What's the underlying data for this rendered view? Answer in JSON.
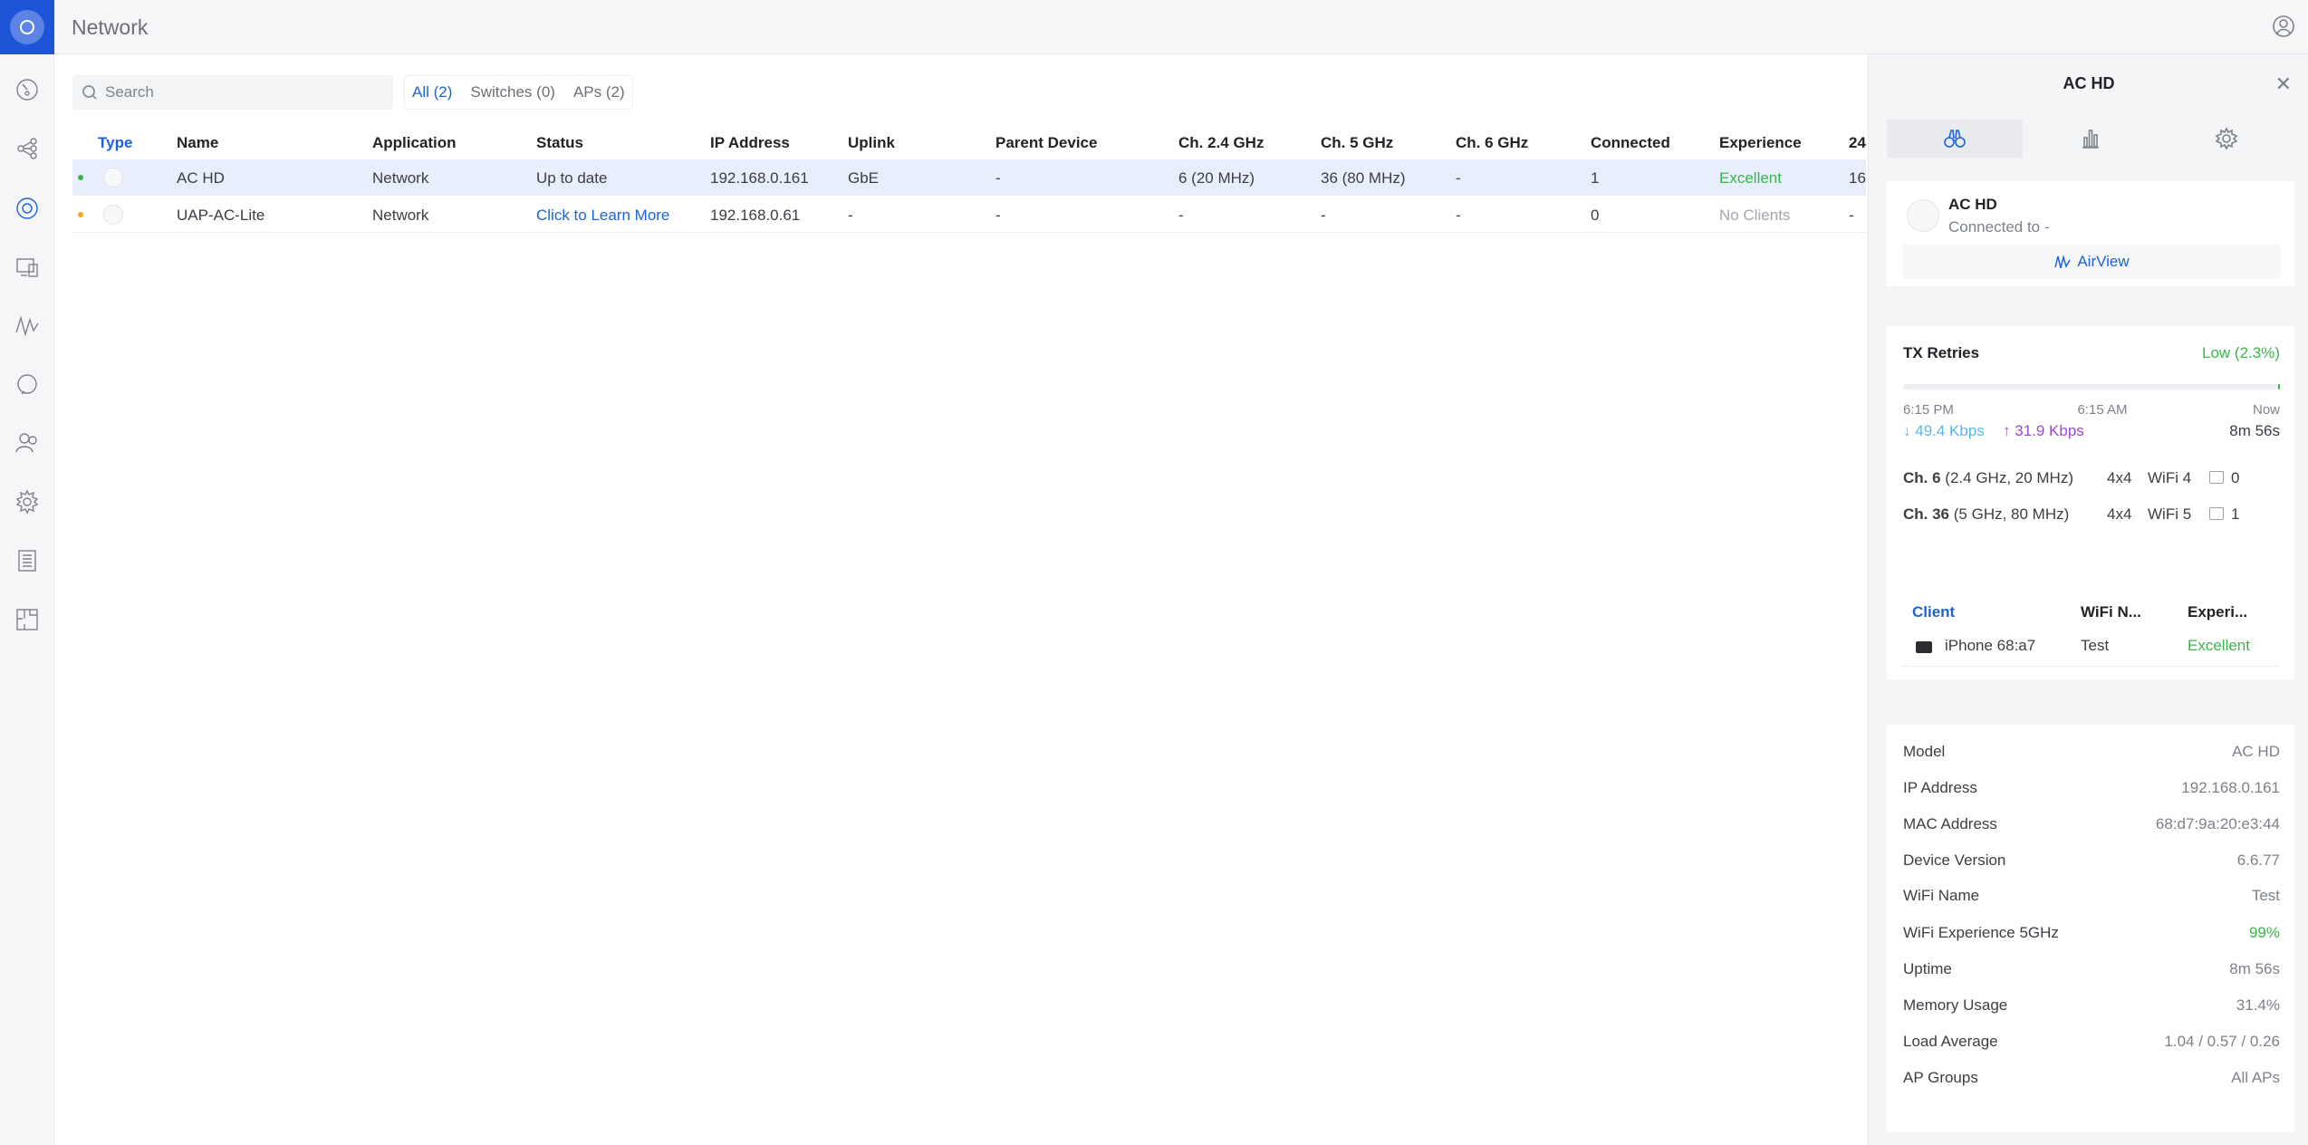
{
  "app": {
    "title": "Network"
  },
  "search": {
    "placeholder": "Search"
  },
  "filters": [
    {
      "label": "All (2)",
      "active": true
    },
    {
      "label": "Switches (0)",
      "active": false
    },
    {
      "label": "APs (2)",
      "active": false
    }
  ],
  "table": {
    "columns": [
      "Type",
      "Name",
      "Application",
      "Status",
      "IP Address",
      "Uplink",
      "Parent Device",
      "Ch. 2.4 GHz",
      "Ch. 5 GHz",
      "Ch. 6 GHz",
      "Connected",
      "Experience",
      "24"
    ],
    "rows": [
      {
        "status_color": "#3ab54a",
        "name": "AC HD",
        "application": "Network",
        "status": "Up to date",
        "ip": "192.168.0.161",
        "uplink": "GbE",
        "parent": "-",
        "ch24": "6 (20 MHz)",
        "ch5": "36 (80 MHz)",
        "ch6": "-",
        "connected": "1",
        "experience": "Excellent",
        "extra": "16"
      },
      {
        "status_color": "#f5a623",
        "name": "UAP-AC-Lite",
        "application": "Network",
        "status": "Click to Learn More",
        "ip": "192.168.0.61",
        "uplink": "-",
        "parent": "-",
        "ch24": "-",
        "ch5": "-",
        "ch6": "-",
        "connected": "0",
        "experience": "No Clients",
        "extra": "-"
      }
    ]
  },
  "panel": {
    "title": "AC HD",
    "tab_icons": [
      "binoculars-icon",
      "bar-chart-icon",
      "gear-icon"
    ],
    "device": {
      "name": "AC HD",
      "connected_to": "Connected to -",
      "airview": "AirView"
    },
    "tx": {
      "label": "TX Retries",
      "value": "Low (2.3%)",
      "retries_fraction": 0.023,
      "times": [
        "6:15 PM",
        "6:15 AM",
        "Now"
      ],
      "down": "49.4 Kbps",
      "up": "31.9 Kbps",
      "uptime": "8m 56s",
      "channels": [
        {
          "ch": "Ch. 6",
          "detail": "(2.4 GHz, 20 MHz)",
          "mimo": "4x4",
          "wifi": "WiFi 4",
          "clients": "0"
        },
        {
          "ch": "Ch. 36",
          "detail": "(5 GHz, 80 MHz)",
          "mimo": "4x4",
          "wifi": "WiFi 5",
          "clients": "1"
        }
      ]
    },
    "clients": {
      "headers": [
        "Client",
        "WiFi N...",
        "Experi..."
      ],
      "rows": [
        {
          "name": "iPhone 68:a7",
          "wifi": "Test",
          "experience": "Excellent"
        }
      ]
    },
    "details": [
      {
        "k": "Model",
        "v": "AC HD"
      },
      {
        "k": "IP Address",
        "v": "192.168.0.161"
      },
      {
        "k": "MAC Address",
        "v": "68:d7:9a:20:e3:44"
      },
      {
        "k": "Device Version",
        "v": "6.6.77"
      },
      {
        "k": "WiFi Name",
        "v": "Test"
      },
      {
        "k": "WiFi Experience 5GHz",
        "v": "99%",
        "green": true
      },
      {
        "k": "Uptime",
        "v": "8m 56s"
      },
      {
        "k": "Memory Usage",
        "v": "31.4%"
      },
      {
        "k": "Load Average",
        "v": "1.04 / 0.57 / 0.26"
      },
      {
        "k": "AP Groups",
        "v": "All APs"
      }
    ]
  },
  "colors": {
    "accent": "#1e63d6",
    "green": "#3ab54a",
    "orange": "#f5a623",
    "upload": "#9b4bd1",
    "download": "#5bb7e8"
  }
}
